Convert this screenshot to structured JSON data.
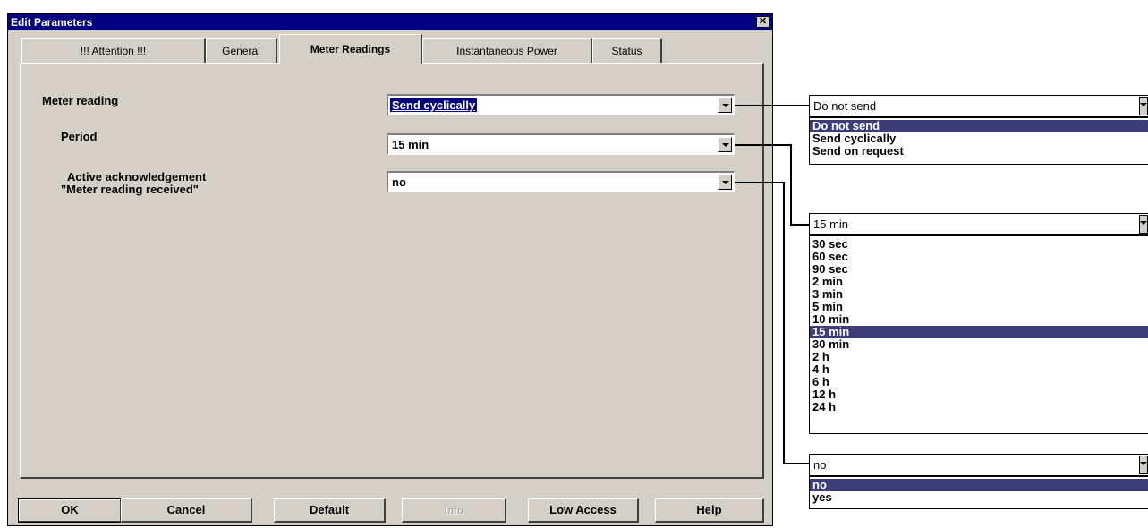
{
  "dialog": {
    "title": "Edit Parameters",
    "close_glyph": "✕"
  },
  "tabs": [
    {
      "label": "!!! Attention !!!"
    },
    {
      "label": "General"
    },
    {
      "label": "Meter Readings"
    },
    {
      "label": "Instantaneous Power"
    },
    {
      "label": "Status"
    }
  ],
  "params": {
    "meter_reading": {
      "label": "Meter reading",
      "value": "Send cyclically"
    },
    "period": {
      "label": "Period",
      "value": "15 min"
    },
    "ack": {
      "label_line1": "Active acknowledgement",
      "label_line2": "\"Meter reading received\"",
      "value": "no"
    }
  },
  "buttons": {
    "ok": "OK",
    "cancel": "Cancel",
    "default": "Default",
    "info": "Info",
    "low_access": "Low Access",
    "help": "Help"
  },
  "dropdown_meter_reading": {
    "selected": "Do not send",
    "options": [
      "Do not send",
      "Send cyclically",
      "Send on request"
    ],
    "highlighted": "Do not send"
  },
  "dropdown_period": {
    "selected": "15 min",
    "options": [
      "30 sec",
      "60 sec",
      "90 sec",
      "2 min",
      "3 min",
      "5 min",
      "10 min",
      "15 min",
      "30 min",
      "2 h",
      "4 h",
      "6 h",
      "12 h",
      "24 h"
    ],
    "highlighted": "15 min"
  },
  "dropdown_ack": {
    "selected": "no",
    "options": [
      "no",
      "yes"
    ],
    "highlighted": "no"
  },
  "colors": {
    "dialog_bg": "#d4d0c8",
    "titlebar": "#000080",
    "highlight": "#3c3c78"
  }
}
